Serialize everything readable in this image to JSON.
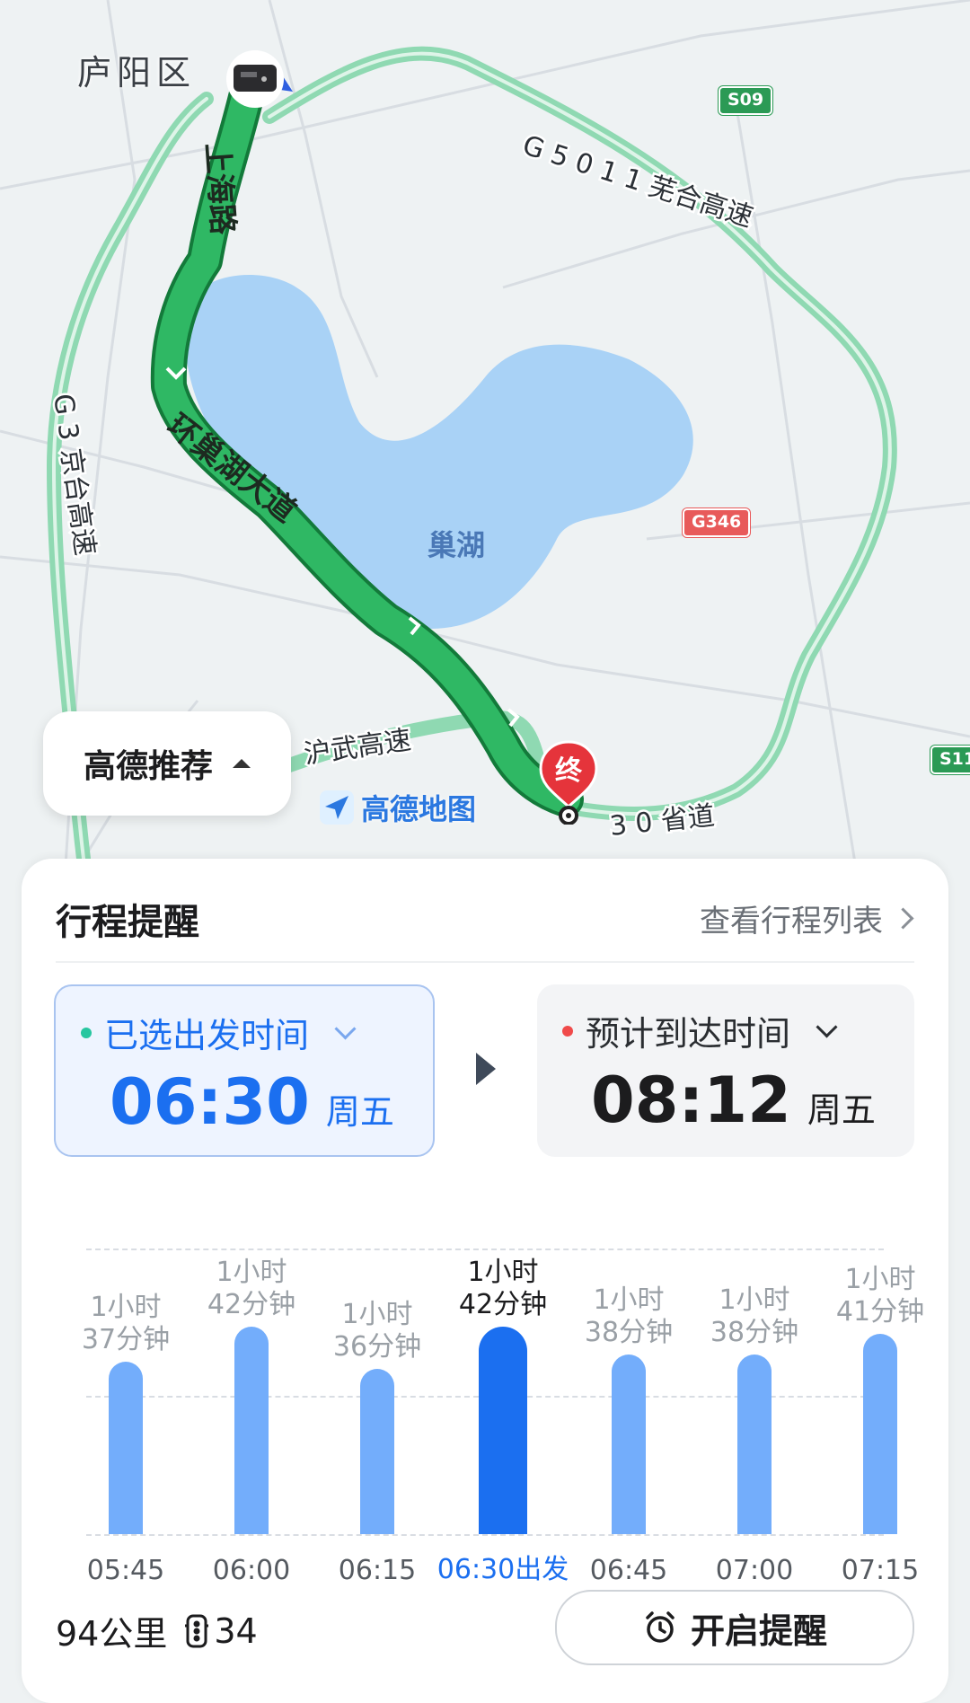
{
  "map": {
    "district_label": "庐阳区",
    "lake_label": "巢湖",
    "road_labels": {
      "g5011": "G 5 0 1 1 芜合高速",
      "g3": "G 3 京台高速",
      "hurong": "沪武高速",
      "provincial": "3 0 省道"
    },
    "route_labels": {
      "shanghai_road": "上海路",
      "huanchaohu": "环巢湖大道"
    },
    "shields": {
      "s09": "S09",
      "g346": "G346",
      "s11": "S11"
    },
    "end_marker": "终",
    "brand_name": "高德地图",
    "recommend_label": "高德推荐"
  },
  "colors": {
    "route": "#1fa54f",
    "highway": "#8fd9b2",
    "lake": "#a9d2f6",
    "accent": "#1b6ff0",
    "depart_dot": "#27c6a0",
    "arrive_dot": "#f04a4a"
  },
  "trip": {
    "title": "行程提醒",
    "list_link": "查看行程列表",
    "depart": {
      "label": "已选出发时间",
      "time": "06:30",
      "day": "周五"
    },
    "arrive": {
      "label": "预计到达时间",
      "time": "08:12",
      "day": "周五"
    },
    "distance": "94公里",
    "traffic_lights": "34",
    "remind_button": "开启提醒"
  },
  "chart_data": {
    "type": "bar",
    "categories": [
      "05:45",
      "06:00",
      "06:15",
      "06:30出发",
      "06:45",
      "07:00",
      "07:15"
    ],
    "values": [
      97,
      102,
      96,
      102,
      98,
      98,
      101
    ],
    "labels": [
      [
        "1小时",
        "37分钟"
      ],
      [
        "1小时",
        "42分钟"
      ],
      [
        "1小时",
        "36分钟"
      ],
      [
        "1小时",
        "42分钟"
      ],
      [
        "1小时",
        "38分钟"
      ],
      [
        "1小时",
        "38分钟"
      ],
      [
        "1小时",
        "41分钟"
      ]
    ],
    "selected_index": 3,
    "unit": "minutes",
    "ylim": [
      0,
      120
    ]
  }
}
